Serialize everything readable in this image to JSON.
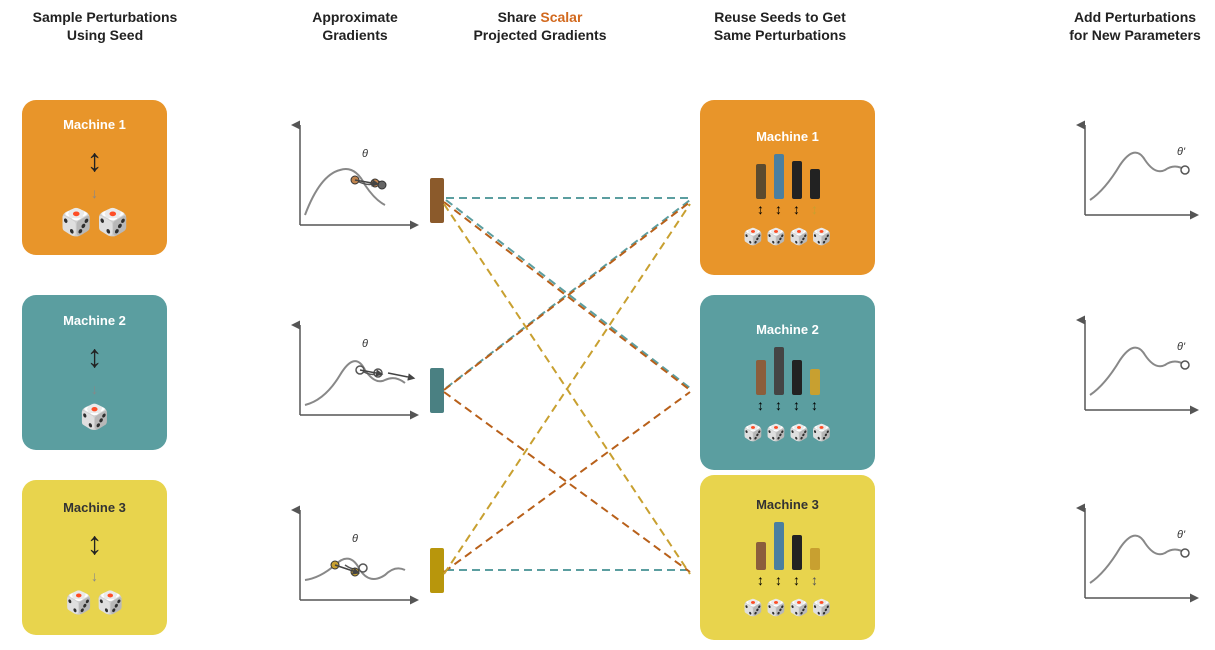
{
  "headers": {
    "col1": "Sample Perturbations\nUsing Seed",
    "col2": "Approximate\nGradients",
    "col3_line1": "Share ",
    "col3_scalar": "Scalar",
    "col3_line2": "Projected Gradients",
    "col4": "Reuse Seeds to Get\nSame Perturbations",
    "col5": "Add Perturbations\nfor New Parameters"
  },
  "machines_left": [
    {
      "label": "Machine 1",
      "color": "#E8952A",
      "row": 1
    },
    {
      "label": "Machine 2",
      "color": "#5B9EA0",
      "row": 2
    },
    {
      "label": "Machine 3",
      "color": "#E8D44D",
      "row": 3,
      "dark": true
    }
  ],
  "machines_right": [
    {
      "label": "Machine 1",
      "color": "#E8952A",
      "row": 1
    },
    {
      "label": "Machine 2",
      "color": "#5B9EA0",
      "row": 2
    },
    {
      "label": "Machine 3",
      "color": "#E8D44D",
      "row": 3,
      "dark": true
    }
  ],
  "colors": {
    "orange": "#E8952A",
    "teal": "#5B9EA0",
    "yellow": "#E8D44D",
    "brown": "#8B5E3C",
    "scalar_color": "#D2691E"
  }
}
